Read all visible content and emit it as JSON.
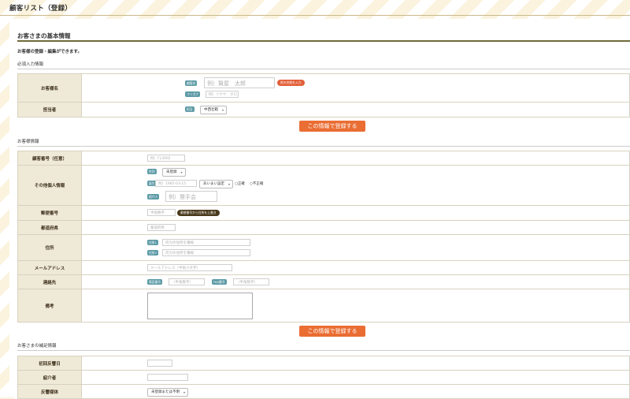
{
  "page": {
    "title": "顧客リスト（登録）"
  },
  "basic": {
    "heading": "お客さまの基本情報",
    "note": "お客様の登録・編集ができます。",
    "required_heading": "必須入力情報",
    "name": {
      "label": "お客様名",
      "name_tag": "顧客名",
      "name_placeholder": "例）賢屋　太郎",
      "honorific_button": "姓の名前を入力",
      "kana_tag": "フリガナ",
      "kana_placeholder": "例）リケヤ　タロ"
    },
    "staff": {
      "label": "担当者",
      "tag": "担当",
      "value": "中西壮範"
    }
  },
  "register_button": "この情報で登録する",
  "info": {
    "heading": "お客様情報",
    "customer_no": {
      "label": "顧客番号（任意）",
      "placeholder": "例）FL3002"
    },
    "personal": {
      "label": "その他個人情報",
      "gender_tag": "性別",
      "gender_value": "未登録",
      "birth_tag": "誕生日",
      "birth_placeholder": "例）1985-03-15",
      "precision_value": "あいまい設定",
      "radio_exact": "○正確",
      "radio_inexact": "○不正確",
      "introducer_tag": "紹介人",
      "introducer_placeholder": "例）鷲手会"
    },
    "zip": {
      "label": "郵便番号",
      "placeholder": "半角数字",
      "button": "郵便番号から住所を上書き"
    },
    "pref": {
      "label": "都道府県",
      "placeholder": "都道府県"
    },
    "address": {
      "label": "住所",
      "tag1": "住所1",
      "placeholder1": "何力の住所を番線",
      "tag2": "住所2",
      "placeholder2": "何力の住所を番線"
    },
    "email": {
      "label": "メールアドレス",
      "placeholder": "メールアドレス（半角小文字）"
    },
    "contact": {
      "label": "連絡先",
      "phone_tag": "電話番号",
      "phone_placeholder": "（半角数字）",
      "fax_tag": "FAX番号",
      "fax_placeholder": "（半角数字）"
    },
    "memo": {
      "label": "備考"
    }
  },
  "extra": {
    "heading": "お客さまの補足情報",
    "first_visit": {
      "label": "初回反響日"
    },
    "referrer": {
      "label": "紹介者"
    },
    "media": {
      "label": "反響媒体",
      "value": "未登録または不明"
    }
  },
  "colors": {
    "accent": "#ea6d33",
    "tag": "#5c9aa6",
    "label_bg": "#efe9d7",
    "rule": "#6f6a3a"
  }
}
